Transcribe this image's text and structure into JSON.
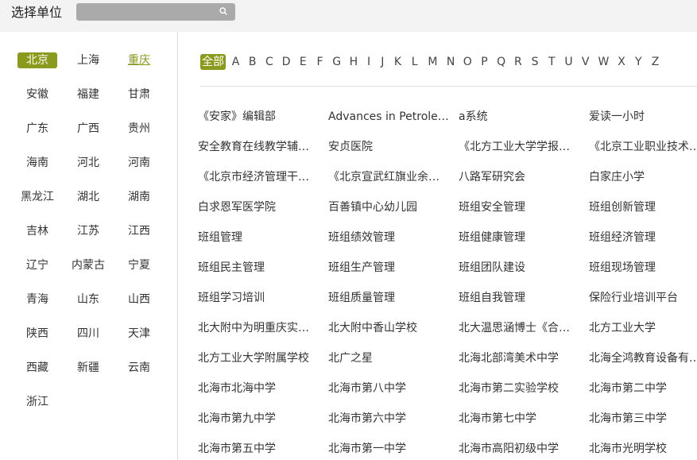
{
  "header": {
    "title": "选择单位",
    "search_placeholder": ""
  },
  "sidebar": {
    "provinces": [
      [
        "北京",
        "上海",
        "重庆"
      ],
      [
        "安徽",
        "福建",
        "甘肃"
      ],
      [
        "广东",
        "广西",
        "贵州"
      ],
      [
        "海南",
        "河北",
        "河南"
      ],
      [
        "黑龙江",
        "湖北",
        "湖南"
      ],
      [
        "吉林",
        "江苏",
        "江西"
      ],
      [
        "辽宁",
        "内蒙古",
        "宁夏"
      ],
      [
        "青海",
        "山东",
        "山西"
      ],
      [
        "陕西",
        "四川",
        "天津"
      ],
      [
        "西藏",
        "新疆",
        "云南"
      ],
      [
        "浙江"
      ]
    ],
    "active": "北京",
    "highlighted": "重庆"
  },
  "main": {
    "letters": [
      "全部",
      "A",
      "B",
      "C",
      "D",
      "E",
      "F",
      "G",
      "H",
      "I",
      "J",
      "K",
      "L",
      "M",
      "N",
      "O",
      "P",
      "Q",
      "R",
      "S",
      "T",
      "U",
      "V",
      "W",
      "X",
      "Y",
      "Z"
    ],
    "units": [
      [
        "《安家》编辑部",
        "Advances in Petroleum Exploration and Development",
        "a系统",
        "爱读一小时"
      ],
      [
        "安全教育在线教学辅导平台",
        "安贞医院",
        "《北方工业大学学报》编辑部",
        "《北京工业职业技术学院学报》"
      ],
      [
        "《北京市经济管理干部学院学报》",
        "《北京宣武红旗业余大学学报》",
        "八路军研究会",
        "白家庄小学"
      ],
      [
        "白求恩军医学院",
        "百善镇中心幼儿园",
        "班组安全管理",
        "班组创新管理"
      ],
      [
        "班组管理",
        "班组绩效管理",
        "班组健康管理",
        "班组经济管理"
      ],
      [
        "班组民主管理",
        "班组生产管理",
        "班组团队建设",
        "班组现场管理"
      ],
      [
        "班组学习培训",
        "班组质量管理",
        "班组自我管理",
        "保险行业培训平台"
      ],
      [
        "北大附中为明重庆实验学校",
        "北大附中香山学校",
        "北大温思涵博士《合唱》",
        "北方工业大学"
      ],
      [
        "北方工业大学附属学校",
        "北广之星",
        "北海北部湾美术中学",
        "北海全鸿教育设备有限公司"
      ],
      [
        "北海市北海中学",
        "北海市第八中学",
        "北海市第二实验学校",
        "北海市第二中学"
      ],
      [
        "北海市第九中学",
        "北海市第六中学",
        "北海市第七中学",
        "北海市第三中学"
      ],
      [
        "北海市第五中学",
        "北海市第一中学",
        "北海市高阳初级中学",
        "北海市光明学校"
      ]
    ]
  }
}
